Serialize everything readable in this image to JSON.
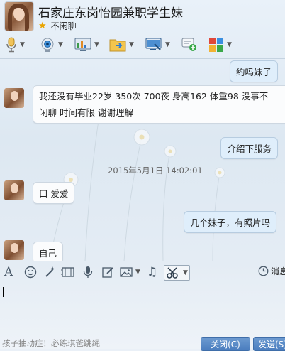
{
  "header": {
    "title": "石家庄东岗怡园兼职学生妹",
    "status_text": "不闲聊"
  },
  "toolbar": {
    "icons": [
      "microphone-icon",
      "webcam-icon",
      "screen-share-icon",
      "file-transfer-icon",
      "remote-desktop-icon",
      "message-plus-icon",
      "apps-icon"
    ]
  },
  "messages": [
    {
      "side": "right",
      "text": "约吗妹子"
    },
    {
      "side": "left",
      "line1": "我还没有毕业22岁  350次 700夜  身高162  体重98  没事不",
      "line2": "闲聊 时间有限 谢谢理解"
    },
    {
      "side": "right",
      "text": "介绍下服务"
    },
    {
      "side": "center",
      "text": "2015年5月1日  14:02:01"
    },
    {
      "side": "left",
      "text": "口 爱爱"
    },
    {
      "side": "right",
      "text": "几个妹子，有照片吗"
    },
    {
      "side": "left",
      "text": "自己"
    }
  ],
  "input_toolbar": {
    "icons": [
      "font-icon",
      "emoji-icon",
      "magic-wand-icon",
      "gif-icon",
      "voice-icon",
      "edit-icon",
      "image-icon",
      "music-icon",
      "screenshot-scissors-icon"
    ],
    "history_label": "消息"
  },
  "input": {
    "value": ""
  },
  "footer": {
    "ad_text": "孩子抽动症！必练琪爸跳绳",
    "close_label": "关闭(C)",
    "send_label": "发送(S)"
  },
  "colors": {
    "accent": "#4a7dbf",
    "bubble_self": "#dfeefb",
    "bubble_other": "#fbfcfd",
    "star": "#e9a400"
  }
}
